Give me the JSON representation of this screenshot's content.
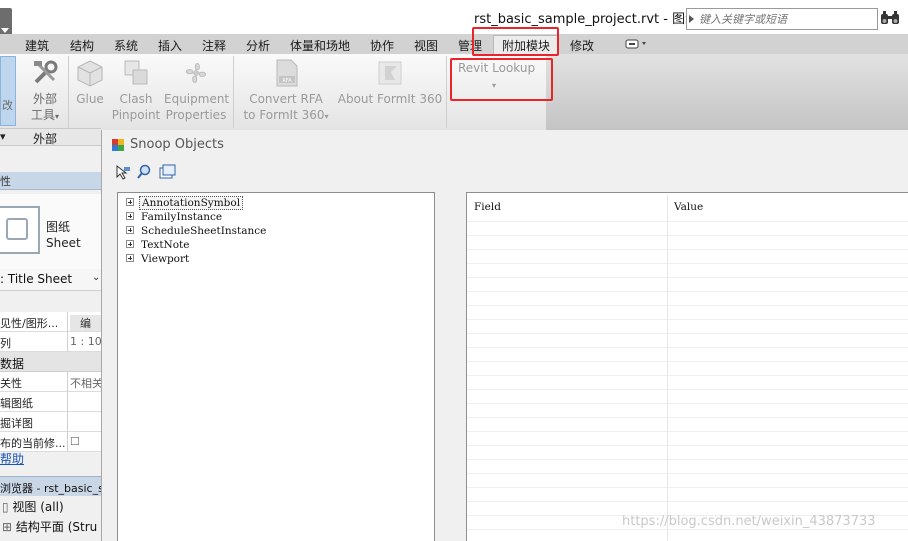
{
  "titlebar": {
    "doc_title": "rst_basic_sample_project.rvt - 图纸...",
    "search_placeholder": "键入关键字或短语",
    "binoculars_icon": "binoculars-icon"
  },
  "tabs": [
    "建筑",
    "结构",
    "系统",
    "插入",
    "注释",
    "分析",
    "体量和场地",
    "协作",
    "视图",
    "管理",
    "附加模块",
    "修改"
  ],
  "active_tab": "附加模块",
  "ribbon": {
    "left_stub_label": "改",
    "external_tools": {
      "line1": "外部",
      "line2": "工具"
    },
    "glue": "Glue",
    "clash": {
      "line1": "Clash",
      "line2": "Pinpoint"
    },
    "equipment": {
      "line1": "Equipment",
      "line2": "Properties"
    },
    "convert": {
      "line1": "Convert RFA",
      "line2": "to FormIt 360"
    },
    "about_formit": "About FormIt 360",
    "revit_lookup": "Revit Lookup"
  },
  "panelbar": {
    "left": "▾",
    "label": "外部"
  },
  "properties": {
    "header": "性",
    "sheet_zh": "图纸",
    "sheet_en": "Sheet",
    "type_select": ": Title Sheet",
    "rows": [
      {
        "k": "见性/图形...",
        "v": "编",
        "kind": "row"
      },
      {
        "k": "列",
        "v": "1 : 10",
        "kind": "row"
      },
      {
        "k": "数据",
        "v": "",
        "kind": "cat"
      },
      {
        "k": "关性",
        "v": "不相关",
        "kind": "row"
      },
      {
        "k": "辑图纸",
        "v": "",
        "kind": "row"
      },
      {
        "k": "掘详图",
        "v": "",
        "kind": "row"
      },
      {
        "k": "布的当前修...",
        "v": "☐",
        "kind": "row"
      }
    ],
    "help": "帮助",
    "browser": "浏览器 - rst_basic_s",
    "tree": [
      {
        "label": "视图 (all)"
      },
      {
        "label": "结构平面 (Stru"
      }
    ]
  },
  "snoop": {
    "title": "Snoop Objects",
    "toolbar": [
      "snoop-select-icon",
      "snoop-search-icon",
      "snoop-copy-icon"
    ],
    "tree": [
      "AnnotationSymbol",
      "FamilyInstance",
      "ScheduleSheetInstance",
      "TextNote",
      "Viewport"
    ],
    "grid_columns": [
      "Field",
      "Value"
    ]
  },
  "watermark": "https://blog.csdn.net/weixin_43873733"
}
